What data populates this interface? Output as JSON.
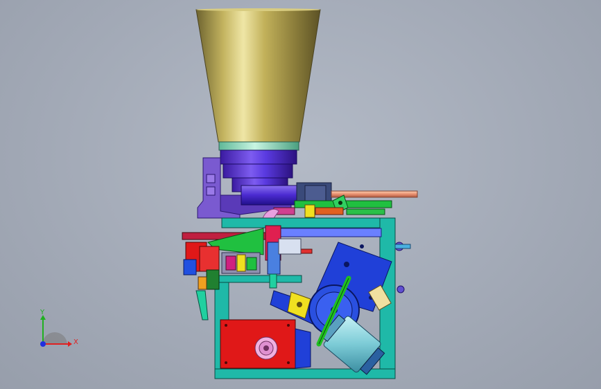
{
  "view": {
    "background": "#a7aeba",
    "triad": {
      "x_label": "X",
      "y_label": "Y",
      "x_color": "#e02020",
      "y_color": "#20b020",
      "z_color": "#2030e0"
    }
  },
  "model": {
    "colors": {
      "hopper": "#b3a24e",
      "hopper_ring": "#8fe0c0",
      "collar": "#5a2ad0",
      "housing": "#7a5ad0",
      "frame": "#1fb9a8",
      "motor": "#8fd8e0",
      "blue_plate": "#2040d8",
      "red_block": "#e01818",
      "yellow_part": "#f0e020",
      "pink_part": "#e8a0e0",
      "green_rod": "#20c020",
      "tube": "#f0a080"
    }
  }
}
